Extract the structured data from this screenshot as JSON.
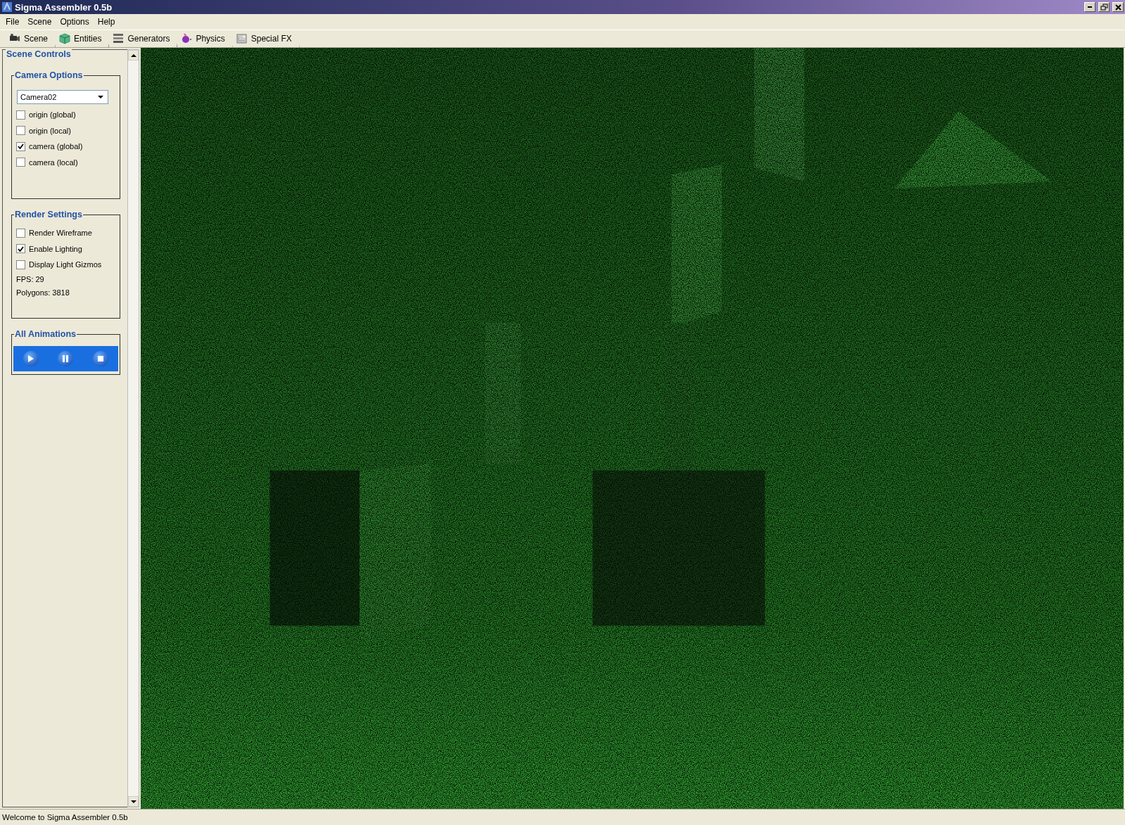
{
  "window": {
    "title": "Sigma Assembler 0.5b"
  },
  "menu": [
    "File",
    "Scene",
    "Options",
    "Help"
  ],
  "tabs": [
    {
      "label": "Scene",
      "kind": "camera"
    },
    {
      "label": "Entities",
      "kind": "cube"
    },
    {
      "label": "Generators",
      "kind": "stack"
    },
    {
      "label": "Physics",
      "kind": "orb"
    },
    {
      "label": "Special FX",
      "kind": "fx"
    }
  ],
  "sidebar": {
    "title": "Scene Controls",
    "groups": [
      {
        "title": "Camera Options",
        "dropdown": {
          "value": "Camera02"
        },
        "items": [
          {
            "kind": "checkbox",
            "label": "origin (global)",
            "checked": false
          },
          {
            "kind": "checkbox",
            "label": "origin (local)",
            "checked": false
          },
          {
            "kind": "checkbox",
            "label": "camera (global)",
            "checked": true
          },
          {
            "kind": "checkbox",
            "label": "camera (local)",
            "checked": false
          }
        ]
      },
      {
        "title": "Render Settings",
        "items": [
          {
            "kind": "checkbox",
            "label": "Render Wireframe",
            "checked": false
          },
          {
            "kind": "checkbox",
            "label": "Enable Lighting",
            "checked": true
          },
          {
            "kind": "checkbox",
            "label": "Display Light Gizmos",
            "checked": false
          },
          {
            "kind": "text",
            "label": "FPS: 29"
          },
          {
            "kind": "text",
            "label": "Polygons: 3818"
          }
        ]
      },
      {
        "title": "All Animations",
        "buttons": [
          {
            "kind": "play"
          },
          {
            "kind": "pause"
          },
          {
            "kind": "stop"
          }
        ]
      }
    ]
  },
  "status_bar": "Welcome to Sigma Assembler 0.5b"
}
